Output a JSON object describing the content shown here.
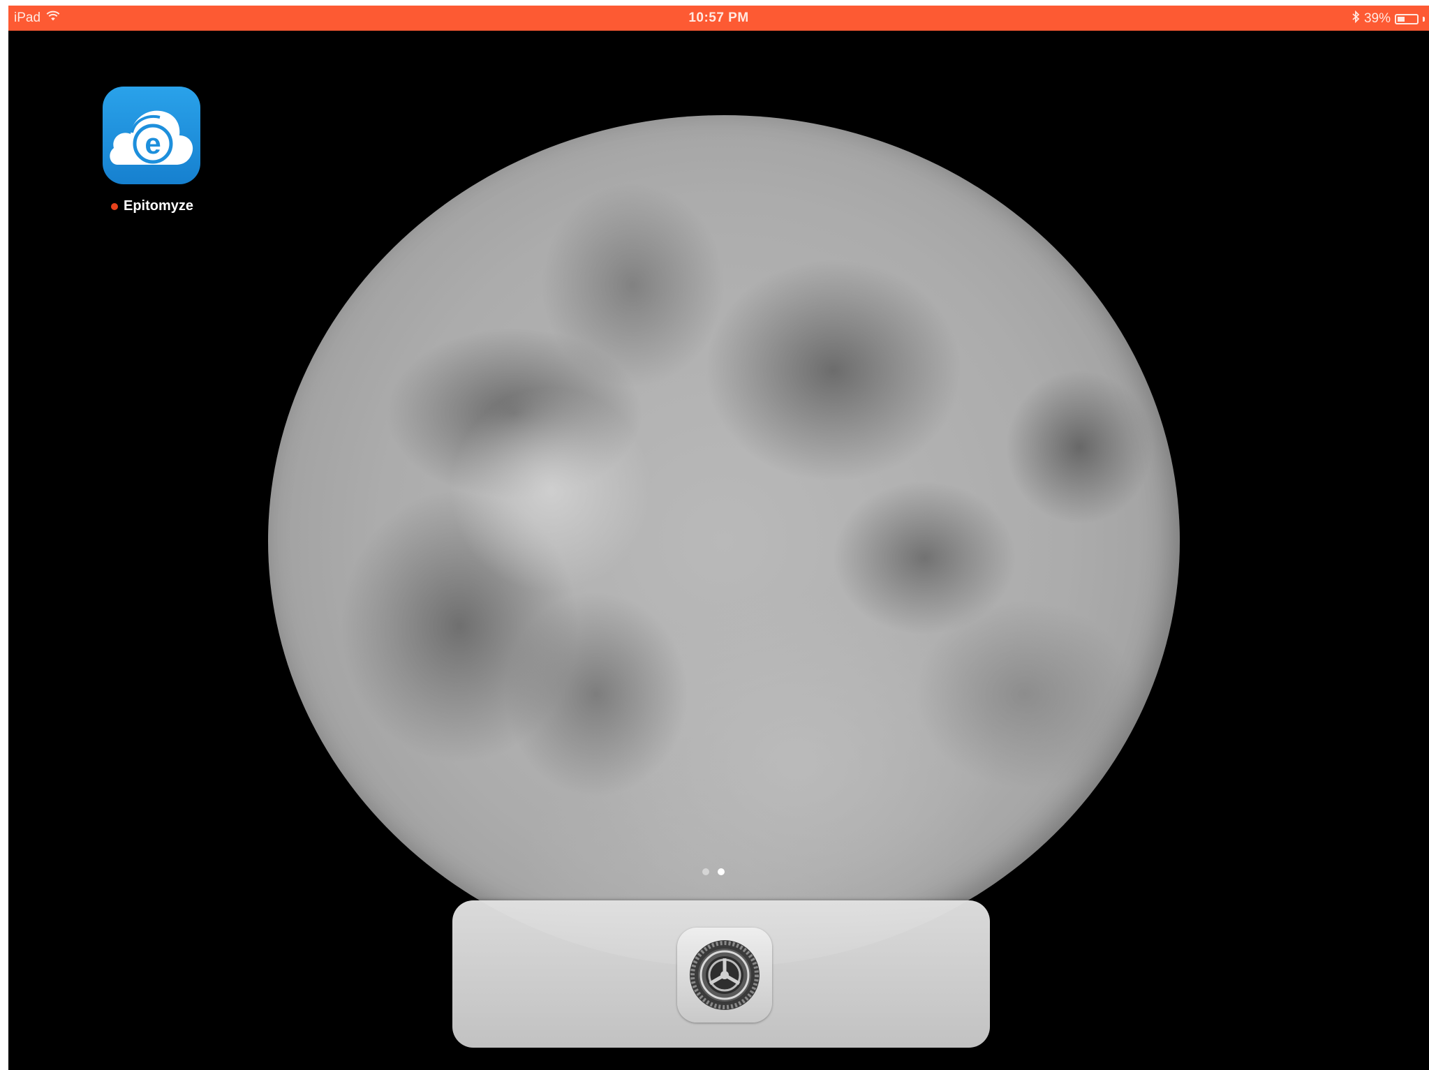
{
  "status_bar": {
    "device_label": "iPad",
    "time": "10:57 PM",
    "battery_percent": "39%",
    "battery_level": 0.39,
    "wifi_icon": "wifi-icon",
    "bluetooth_icon": "bluetooth-icon",
    "background_color": "#fd5a33"
  },
  "home_screen": {
    "apps": [
      {
        "label": "Epitomyze",
        "icon": "epitomyze-cloud-e-icon",
        "badge": "new-install-dot",
        "icon_color": "#1d8fdc"
      }
    ],
    "wallpaper": "moon",
    "page_indicator": {
      "pages": 2,
      "current_page": 2
    }
  },
  "dock": {
    "apps": [
      {
        "name": "Settings",
        "icon": "settings-gear-icon"
      }
    ]
  }
}
